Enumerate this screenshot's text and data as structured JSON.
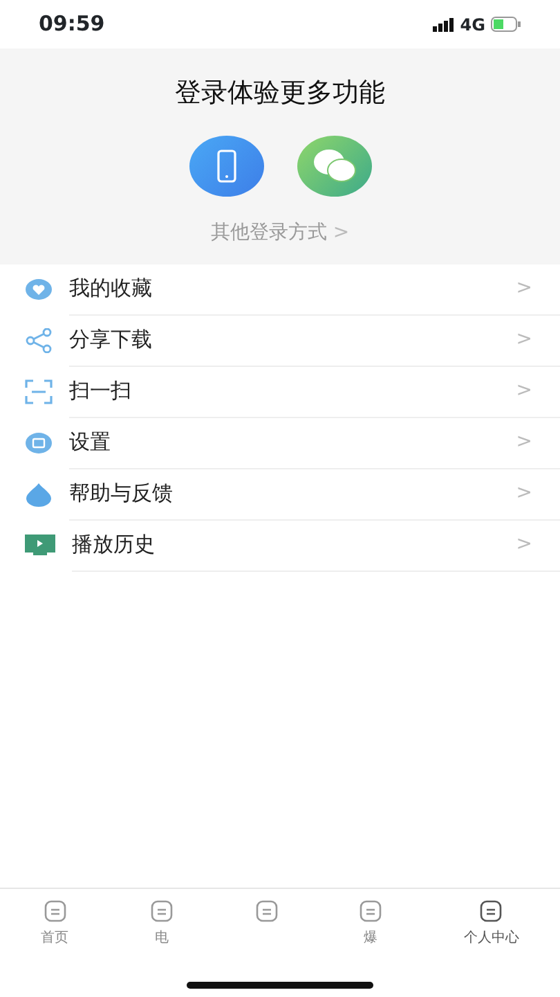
{
  "status_bar": {
    "time": "09:59",
    "network": "4G"
  },
  "login": {
    "title": "登录体验更多功能",
    "methods": [
      {
        "kind": "phone"
      },
      {
        "kind": "wechat"
      }
    ],
    "other": "其他登录方式",
    "other_chevron": ">"
  },
  "menu": [
    {
      "label": "我的收藏",
      "kind": "heart",
      "chevron": ">"
    },
    {
      "label": "分享下载",
      "kind": "share",
      "chevron": ">"
    },
    {
      "label": "扫一扫",
      "kind": "scan",
      "chevron": ">"
    },
    {
      "label": "设置",
      "kind": "settings",
      "chevron": ">"
    },
    {
      "label": "帮助与反馈",
      "kind": "drop",
      "chevron": ">"
    },
    {
      "label": "播放历史",
      "kind": "history",
      "chevron": ">"
    }
  ],
  "tab_bar": [
    {
      "label": "首页",
      "selected": false
    },
    {
      "label": "电",
      "selected": false
    },
    {
      "selected": false
    },
    {
      "label": "爆",
      "selected": false
    },
    {
      "label": "个人中心",
      "selected": true
    }
  ]
}
